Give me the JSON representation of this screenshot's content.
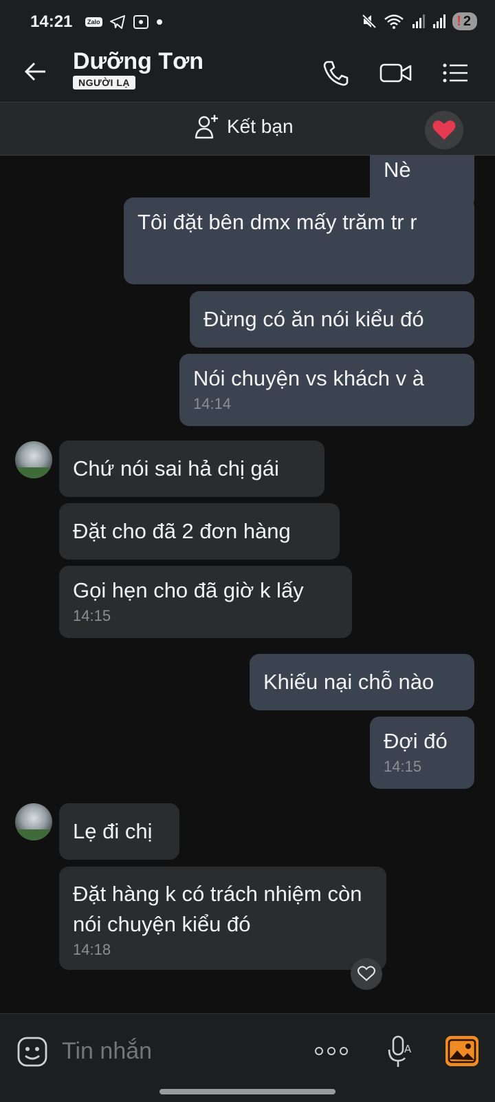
{
  "status_bar": {
    "time": "14:21",
    "zalo_icon_text": "Zalo",
    "battery_label": "2"
  },
  "header": {
    "contact_name": "Dưỡng Tơn",
    "badge": "NGƯỜI LẠ"
  },
  "friend_bar": {
    "add_friend_label": "Kết bạn"
  },
  "messages": [
    {
      "side": "out",
      "text": "Nè",
      "time": ""
    },
    {
      "side": "out",
      "text": "Tôi đặt bên dmx mấy trăm tr r",
      "time": ""
    },
    {
      "side": "out",
      "text": "Đừng có ăn nói kiểu đó",
      "time": ""
    },
    {
      "side": "out",
      "text": "Nói chuyện vs khách v à",
      "time": "14:14"
    },
    {
      "side": "in",
      "text": "Chứ nói sai hả chị gái",
      "time": ""
    },
    {
      "side": "in",
      "text": "Đặt cho đã 2 đơn hàng",
      "time": ""
    },
    {
      "side": "in",
      "text": "Gọi hẹn cho đã giờ k lấy",
      "time": "14:15"
    },
    {
      "side": "out",
      "text": "Khiếu nại chỗ nào",
      "time": ""
    },
    {
      "side": "out",
      "text": "Đợi đó",
      "time": "14:15"
    },
    {
      "side": "in",
      "text": "Lẹ đi chị",
      "time": ""
    },
    {
      "side": "in",
      "text": "Đặt hàng k có trách nhiệm còn nói chuyện kiểu đó",
      "time": "14:18"
    }
  ],
  "composer": {
    "placeholder": "Tin nhắn"
  },
  "colors": {
    "outgoing_bubble": "#3b4350",
    "incoming_bubble": "#2b2c2e",
    "background": "#101010",
    "accent_image_button": "#f08a24",
    "heart": "#e53950"
  }
}
